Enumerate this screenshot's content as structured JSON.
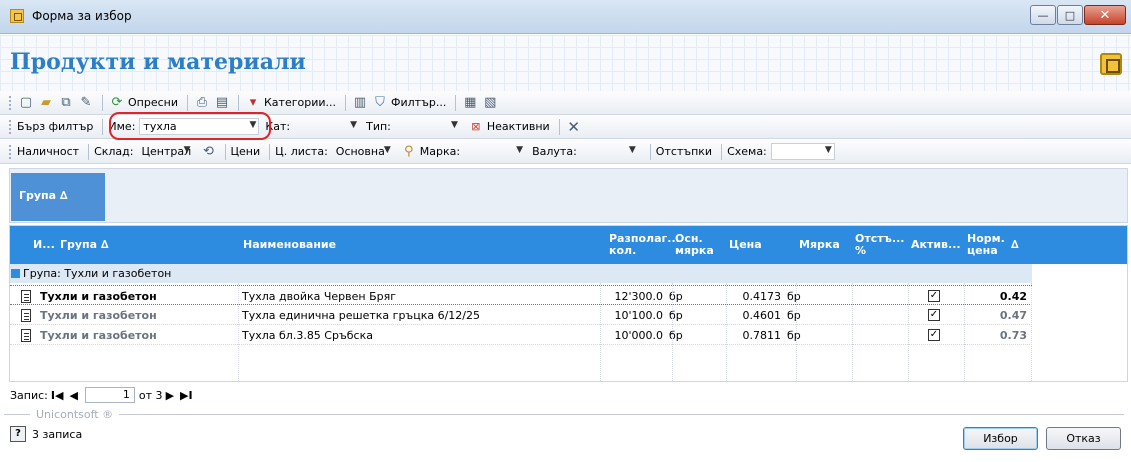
{
  "window": {
    "title": "Форма за избор",
    "min": "—",
    "max": "□",
    "close": "✕"
  },
  "header": {
    "title": "Продукти и материали"
  },
  "toolbar1": {
    "refresh": "Опресни",
    "categories": "Категории...",
    "filter": "Филтър..."
  },
  "toolbar2": {
    "quick_filter": "Бърз филтър",
    "name_label": "Име:",
    "name_value": "тухла",
    "cat_label": "Кат:",
    "cat_value": "",
    "type_label": "Тип:",
    "type_value": "",
    "inactive": "Неактивни"
  },
  "toolbar3": {
    "availability": "Наличност",
    "warehouse_label": "Склад:",
    "warehouse_value": "Централ",
    "prices": "Цени",
    "pricelist_label": "Ц. листа:",
    "pricelist_value": "Основна",
    "brand_label": "Марка:",
    "brand_value": "",
    "currency_label": "Валута:",
    "currency_value": "",
    "discounts": "Отстъпки",
    "scheme_label": "Схема:",
    "scheme_value": ""
  },
  "groupbar": {
    "chip": "Група ∆"
  },
  "grid": {
    "columns": {
      "icon": "И...",
      "group": "Група ∆",
      "name": "Наименование",
      "available": "Разполаг... кол.",
      "unit": "Осн. мярка",
      "price": "Цена",
      "measure": "Мярка",
      "discount": "Отстъ... %",
      "active": "Актив...",
      "norm_price": "Норм. цена",
      "sort": "∆"
    },
    "group_label": "Група: Тухли и газобетон",
    "rows": [
      {
        "group": "Тухли и газобетон",
        "name": "Тухла двойка Червен Бряг",
        "available": "12'300.0",
        "unit": "бр",
        "price": "0.4173",
        "measure": "бр",
        "discount": "",
        "active": "✓",
        "norm_price": "0.42"
      },
      {
        "group": "Тухли и газобетон",
        "name": "Тухла единична решетка гръцка 6/12/25",
        "available": "10'100.0",
        "unit": "бр",
        "price": "0.4601",
        "measure": "бр",
        "discount": "",
        "active": "✓",
        "norm_price": "0.47"
      },
      {
        "group": "Тухли и газобетон",
        "name": "Тухла бл.3.85 Сръбска",
        "available": "10'000.0",
        "unit": "бр",
        "price": "0.7811",
        "measure": "бр",
        "discount": "",
        "active": "✓",
        "norm_price": "0.73"
      }
    ]
  },
  "nav": {
    "label": "Запис:",
    "first": "I◀",
    "prev": "◀",
    "current": "1",
    "of": "от 3",
    "next": "▶",
    "last": "▶I"
  },
  "brand": "Unicontsoft ®",
  "status": {
    "help": "?",
    "records": "3 записа"
  },
  "buttons": {
    "select": "Избор",
    "cancel": "Отказ"
  }
}
